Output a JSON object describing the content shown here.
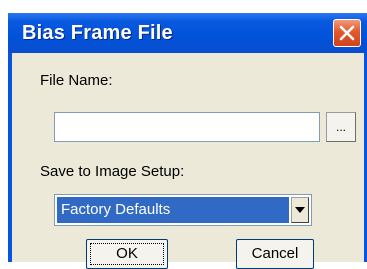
{
  "window": {
    "title": "Bias Frame File",
    "close_icon": "close-x-icon",
    "close_color": "#e3582c",
    "titlebar_color": "#0a5ae0"
  },
  "form": {
    "file_name_label": "File Name:",
    "file_name_value": "",
    "browse_label": "...",
    "save_label": "Save to Image Setup:",
    "setup_selected": "Factory Defaults",
    "dropdown_icon": "chevron-down-icon",
    "selection_color": "#316ac5"
  },
  "buttons": {
    "ok": "OK",
    "cancel": "Cancel"
  }
}
